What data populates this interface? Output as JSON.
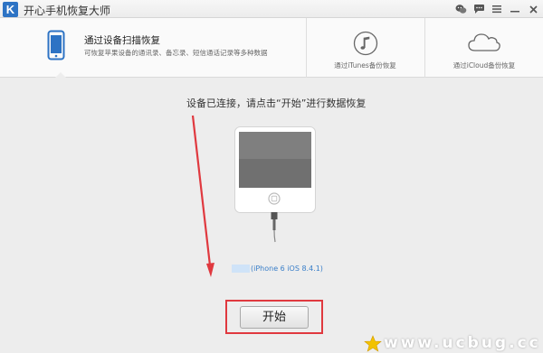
{
  "window": {
    "logo_letter": "K",
    "title": "开心手机恢复大师"
  },
  "titlebar_icons": [
    "wechat-icon",
    "chat-bubble-icon",
    "menu-icon",
    "minimize-icon",
    "close-icon"
  ],
  "tabs": [
    {
      "title": "通过设备扫描恢复",
      "description": "可恢复苹果设备的通讯录、备忘录、短信通话记录等多种数据",
      "icon": "phone-icon",
      "active": true
    },
    {
      "label": "通过iTunes备份恢复",
      "icon": "music-note-icon",
      "active": false
    },
    {
      "label": "通过iCloud备份恢复",
      "icon": "cloud-icon",
      "active": false
    }
  ],
  "main": {
    "instruction": "设备已连接，请点击“开始”进行数据恢复",
    "device_label": "(iPhone 6 iOS 8.4.1)",
    "start_button": "开始"
  },
  "watermark": {
    "text": "www.ucbug.cc"
  },
  "colors": {
    "accent_blue": "#2d73c4",
    "link_blue": "#3a7fc9",
    "highlight_red": "#e0393f"
  }
}
